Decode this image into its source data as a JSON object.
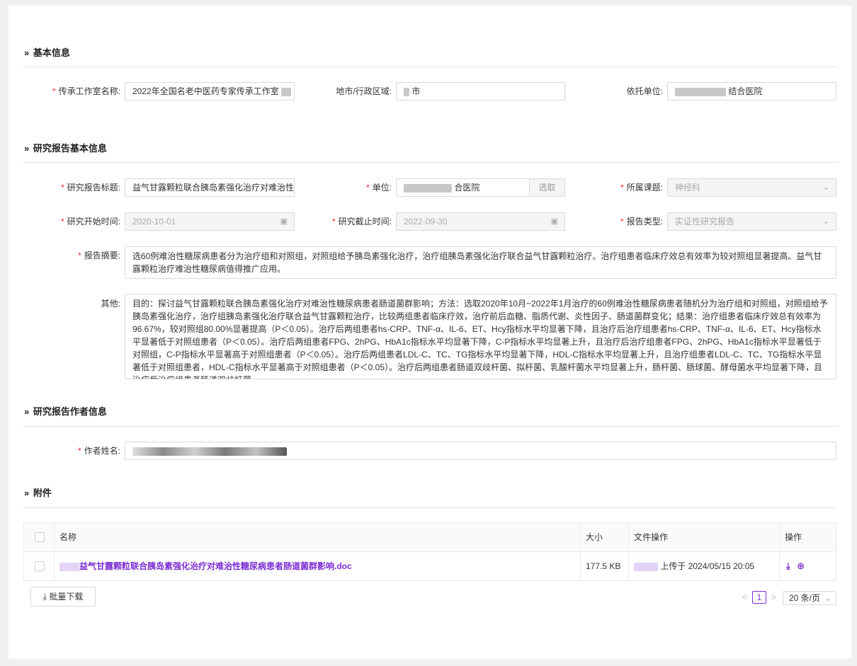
{
  "sections": {
    "basic": "基本信息",
    "report_basic": "研究报告基本信息",
    "authors": "研究报告作者信息",
    "attachments": "附件"
  },
  "basic": {
    "studio_label": "传承工作室名称:",
    "studio_value": "2022年全国名老中医药专家传承工作室",
    "region_label": "地市/行政区域:",
    "region_value": "市",
    "unit_label": "依托单位:",
    "unit_value": "结合医院"
  },
  "report": {
    "title_label": "研究报告标题:",
    "title_value": "益气甘露颗粒联合胰岛素强化治疗对难治性",
    "unit_label": "单位:",
    "unit_value": "合医院",
    "select_button": "选取",
    "topic_label": "所属课题:",
    "topic_value": "神经科",
    "start_label": "研究开始时间:",
    "start_value": "2020-10-01",
    "end_label": "研究截止时间:",
    "end_value": "2022-09-30",
    "type_label": "报告类型:",
    "type_value": "实证性研究报告",
    "abstract_label": "报告摘要:",
    "abstract_value": "选60例难治性糖尿病患者分为治疗组和对照组，对照组给予胰岛素强化治疗，治疗组胰岛素强化治疗联合益气甘露颗粒治疗。治疗组患者临床疗效总有效率为较对照组显著提高。益气甘露颗粒治疗难治性糖尿病值得推广应用。",
    "other_label": "其他:",
    "other_value": "目的：探讨益气甘露颗粒联合胰岛素强化治疗对难治性糖尿病患者肠道菌群影响；方法：选取2020年10月~2022年1月治疗的60例难治性糖尿病患者随机分为治疗组和对照组，对照组给予胰岛素强化治疗，治疗组胰岛素强化治疗联合益气甘露颗粒治疗，比较两组患者临床疗效，治疗前后血糖、脂质代谢、炎性因子、肠道菌群变化；结果：治疗组患者临床疗效总有效率为96.67%，较对照组80.00%显著提高（P＜0.05）。治疗后两组患者hs-CRP、TNF-α、IL-6、ET、Hcy指标水平均显著下降，且治疗后治疗组患者hs-CRP、TNF-α、IL-6、ET、Hcy指标水平显著低于对照组患者（P＜0.05）。治疗后两组患者FPG、2hPG、HbA1c指标水平均显著下降，C-P指标水平均显著上升，且治疗后治疗组患者FPG、2hPG、HbA1c指标水平显著低于对照组，C-P指标水平显著高于对照组患者（P＜0.05）。治疗后两组患者LDL-C、TC、TG指标水平均显著下降，HDL-C指标水平均显著上升，且治疗组患者LDL-C、TC、TG指标水平显著低于对照组患者，HDL-C指标水平显著高于对照组患者（P＜0.05）。治疗后两组患者肠道双歧杆菌、拟杆菌、乳酸杆菌水平均显著上升，肠杆菌、肠球菌、酵母菌水平均显著下降，且治疗后治疗组患者肠道双歧杆菌、"
  },
  "authors": {
    "name_label": "作者姓名:"
  },
  "table": {
    "headers": {
      "name": "名称",
      "size": "大小",
      "file_ops": "文件操作",
      "ops": "操作"
    },
    "rows": [
      {
        "name": "益气甘露颗粒联合胰岛素强化治疗对难治性糖尿病患者肠道菌群影响.doc",
        "size": "177.5 KB",
        "uploaded": "上传于 2024/05/15 20:05"
      }
    ]
  },
  "batch_download": "批量下载",
  "pagination": {
    "page": "1",
    "page_size": "20 条/页"
  },
  "icons": {
    "section": "double-chevron-right-icon",
    "calendar": "calendar-icon",
    "dropdown": "chevron-down-icon",
    "download": "download-icon",
    "preview": "zoom-in-icon"
  },
  "colors": {
    "accent": "#7b2dd3",
    "required": "#f5222d"
  }
}
